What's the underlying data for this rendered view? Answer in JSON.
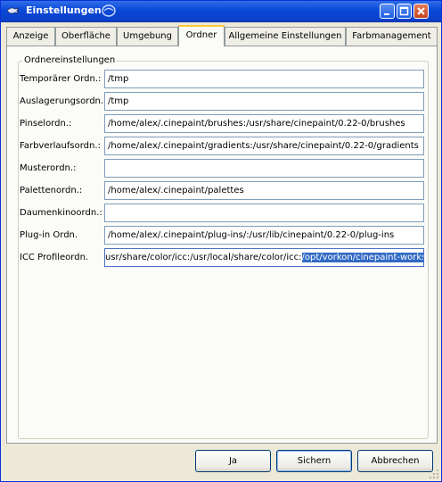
{
  "window": {
    "title": "Einstellungen",
    "icon": "gimp-pencil-icon",
    "logo": "cinepaint-logo-icon"
  },
  "tabs": [
    {
      "label": "Anzeige"
    },
    {
      "label": "Oberfläche"
    },
    {
      "label": "Umgebung"
    },
    {
      "label": "Ordner",
      "active": true
    },
    {
      "label": "Allgemeine Einstellungen"
    },
    {
      "label": "Farbmanagement"
    }
  ],
  "group": {
    "label": "Ordnereinstellungen"
  },
  "folders": [
    {
      "label": "Temporärer Ordn.:",
      "value": "/tmp"
    },
    {
      "label": "Auslagerungsordn.:",
      "value": "/tmp"
    },
    {
      "label": "Pinselordn.:",
      "value": "/home/alex/.cinepaint/brushes:/usr/share/cinepaint/0.22-0/brushes"
    },
    {
      "label": "Farbverlaufsordn.:",
      "value": "/home/alex/.cinepaint/gradients:/usr/share/cinepaint/0.22-0/gradients"
    },
    {
      "label": "Musterordn.:",
      "value": ""
    },
    {
      "label": "Palettenordn.:",
      "value": "/home/alex/.cinepaint/palettes"
    },
    {
      "label": "Daumenkinoordn.:",
      "value": ""
    },
    {
      "label": "Plug-in Ordn.",
      "value": "/home/alex/.cinepaint/plug-ins/:/usr/lib/cinepaint/0.22-0/plug-ins"
    },
    {
      "label": "ICC Profileordn.",
      "value_visible": "usr/share/color/icc:/usr/local/share/color/icc:",
      "value_selected": "/opt/vorkon/cinepaint-workshop"
    }
  ],
  "buttons": {
    "ok": "Ja",
    "save": "Sichern",
    "cancel": "Abbrechen"
  },
  "colors": {
    "titlebar": "#0a48d8",
    "active_tab_accent": "#ffc73c",
    "selection": "#316ac5"
  }
}
